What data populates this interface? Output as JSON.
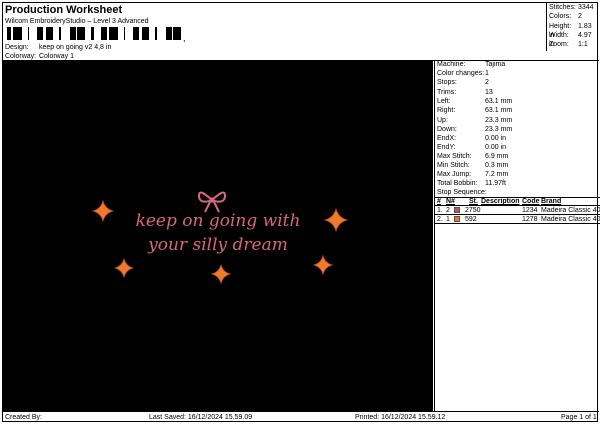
{
  "header": {
    "title": "Production Worksheet",
    "subtitle": "Wilcom EmbroideryStudio – Level 3 Advanced",
    "barcode_mark": ",",
    "design_label": "Design:",
    "design_value": "keep on going v2 4,8 in",
    "colorway_label": "Colorway:",
    "colorway_value": "Colorway 1"
  },
  "stats": [
    {
      "label": "Stitches:",
      "value": "3344"
    },
    {
      "label": "Colors:",
      "value": "2"
    },
    {
      "label": "Height:",
      "value": "1.83 in"
    },
    {
      "label": "Width:",
      "value": "4.97 in"
    },
    {
      "label": "Zoom:",
      "value": "1:1"
    }
  ],
  "design_text": {
    "line1": "keep on going with",
    "line2": "your silly dream"
  },
  "machine_info": [
    {
      "label": "Machine:",
      "value": "Tajima"
    },
    {
      "label": "Color changes:",
      "value": "1"
    },
    {
      "label": "Stops:",
      "value": "2"
    },
    {
      "label": "Trims:",
      "value": "13"
    },
    {
      "label": "Left:",
      "value": "63.1 mm"
    },
    {
      "label": "Right:",
      "value": "63.1 mm"
    },
    {
      "label": "Up:",
      "value": "23.3 mm"
    },
    {
      "label": "Down:",
      "value": "23.3 mm"
    },
    {
      "label": "EndX:",
      "value": "0.00 in"
    },
    {
      "label": "EndY:",
      "value": "0.00 in"
    },
    {
      "label": "Max Stitch:",
      "value": "6.9 mm"
    },
    {
      "label": "Min Stitch:",
      "value": "0.3 mm"
    },
    {
      "label": "Max Jump:",
      "value": "7.2 mm"
    },
    {
      "label": "Total Bobbin:",
      "value": "11.97ft"
    }
  ],
  "stop_sequence": {
    "title": "Stop Sequence:",
    "headers": {
      "num": "#",
      "n": "N#",
      "st": "St.",
      "desc": "Description",
      "code": "Code",
      "brand": "Brand"
    },
    "rows": [
      {
        "num": "1.",
        "n": "2",
        "swatch": "#c8506c",
        "st": "2750",
        "desc": "",
        "code": "1234",
        "brand": "Madeira Classic 40"
      },
      {
        "num": "2.",
        "n": "1",
        "swatch": "#f07a2c",
        "st": "592",
        "desc": "",
        "code": "1278",
        "brand": "Madeira Classic 40"
      }
    ]
  },
  "footer": {
    "created_by": "Created By:",
    "last_saved": "Last Saved: 16/12/2024 15.59.09",
    "printed": "Printed: 16/12/2024 15.59.12",
    "page": "Page 1 of 1"
  },
  "colors": {
    "text_thread": "#d9667f",
    "star_thread": "#f07a2c",
    "canvas_bg": "#000000"
  }
}
